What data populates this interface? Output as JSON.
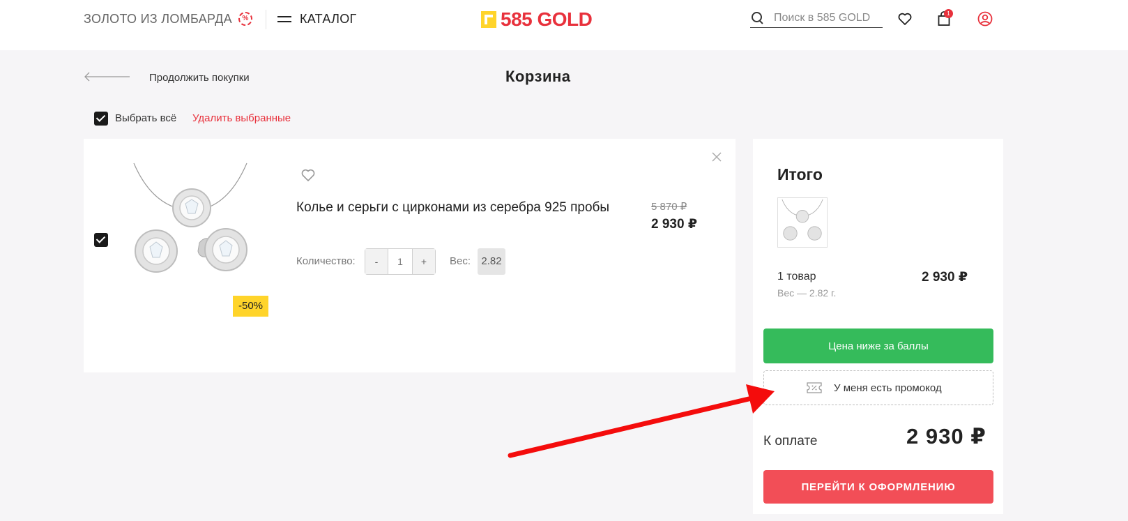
{
  "header": {
    "lombard_label": "ЗОЛОТО ИЗ ЛОМБАРДА",
    "percent_badge": "%",
    "catalog_label": "КАТАЛОГ",
    "logo_text": "585 GOLD",
    "search_placeholder": "Поиск в 585 GOLD",
    "cart_count": "1",
    "icons": [
      "percent-icon",
      "burger-icon",
      "search-icon",
      "heart-icon",
      "cart-icon",
      "user-icon"
    ]
  },
  "nav": {
    "back_label": "Продолжить покупки",
    "page_title": "Корзина"
  },
  "selection": {
    "select_all_label": "Выбрать всё",
    "select_all_checked": true,
    "delete_selected_label": "Удалить выбранные"
  },
  "cart_item": {
    "title": "Колье и серьги с цирконами из серебра 925 пробы",
    "discount": "-50%",
    "old_price": "5 870 ₽",
    "new_price": "2 930 ₽",
    "qty_label": "Количество:",
    "qty_minus": "-",
    "qty_value": "1",
    "qty_plus": "+",
    "weight_label": "Вес:",
    "weight_value": "2.82",
    "checked": true
  },
  "summary": {
    "title": "Итого",
    "count_label": "1 товар",
    "weight_label": "Вес — 2.82 г.",
    "sum": "2 930 ₽",
    "points_button": "Цена ниже за баллы",
    "promo_button": "У меня есть промокод",
    "to_pay_label": "К оплате",
    "to_pay_sum": "2 930 ₽",
    "checkout_button": "ПЕРЕЙТИ К ОФОРМЛЕНИЮ"
  },
  "colors": {
    "brand_red": "#e8313c",
    "brand_yellow": "#ffd42a",
    "green": "#35bb5b",
    "checkout_red": "#f24e57",
    "page_bg": "#f6f5f7"
  }
}
